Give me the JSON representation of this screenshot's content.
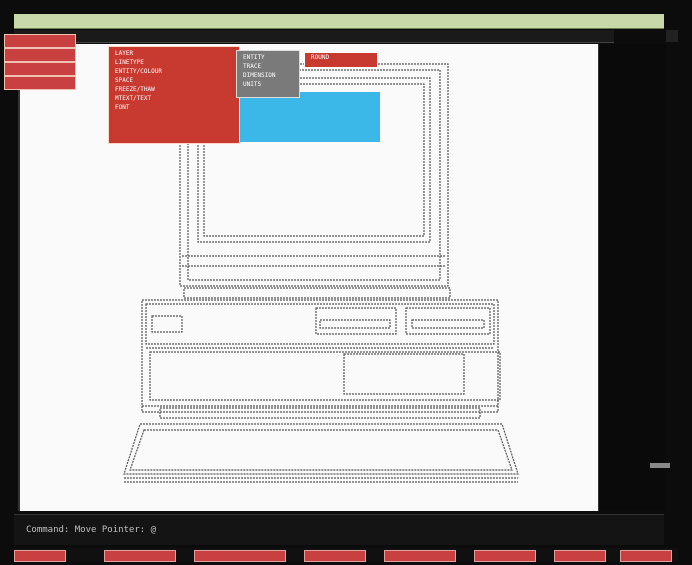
{
  "window": {
    "title": "",
    "colors": {
      "canvas": "#fafafa",
      "menu_red": "#c83a30",
      "accent_cyan": "#3cb8e8",
      "bg": "#0c0c0c"
    }
  },
  "toolbar": {
    "buttons": [
      "",
      "",
      "",
      ""
    ]
  },
  "dropdown": {
    "items": [
      "LAYER",
      "LINETYPE",
      "ENTITY/COLOUR",
      "SPACE",
      "FREEZE/THAW",
      "MTEXT/TEXT",
      "FONT"
    ]
  },
  "submenu": {
    "items": [
      "ENTITY",
      "TRACE",
      "DIMENSION",
      "UNITS"
    ]
  },
  "subsubmenu": {
    "items": [
      "ROUND"
    ]
  },
  "command": {
    "text": "Command: Move Pointer: @"
  }
}
